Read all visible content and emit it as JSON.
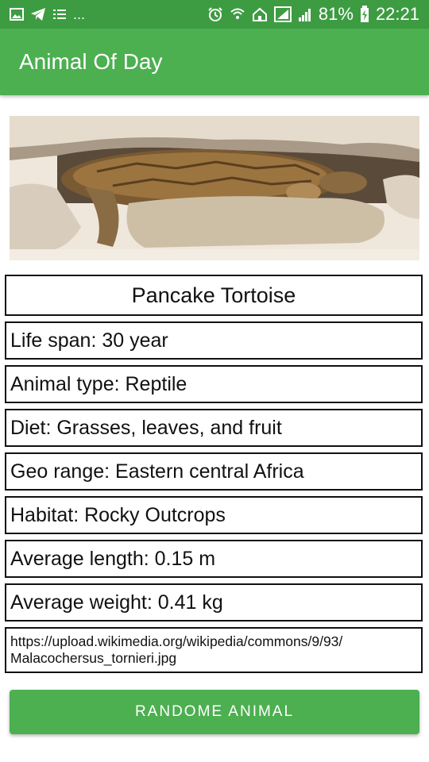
{
  "status_bar": {
    "left_icons": [
      "image-icon",
      "telegram-icon",
      "list-icon"
    ],
    "overflow": "...",
    "right_icons": [
      "alarm-icon",
      "wifi-icon",
      "home-icon",
      "signal-icon",
      "signal-icon",
      "battery-charging-icon"
    ],
    "battery": "81%",
    "time": "22:21"
  },
  "app_bar": {
    "title": "Animal Of Day"
  },
  "animal": {
    "name": "Pancake Tortoise",
    "life_span": "Life span:   30 year",
    "animal_type": "Animal type: Reptile",
    "diet": "Diet: Grasses, leaves, and fruit",
    "geo_range": "Geo range: Eastern central Africa",
    "habitat": "Habitat: Rocky Outcrops",
    "avg_length": "Average length: 0.15 m",
    "avg_weight": "Average weight: 0.41 kg",
    "image_url_line1": "https://upload.wikimedia.org/wikipedia/commons/9/93/",
    "image_url_line2": "Malacochersus_tornieri.jpg"
  },
  "button": {
    "label": "RANDOME ANIMAL"
  },
  "colors": {
    "status_bar": "#3d9c42",
    "app_bar": "#4caf50",
    "button": "#4caf50"
  }
}
